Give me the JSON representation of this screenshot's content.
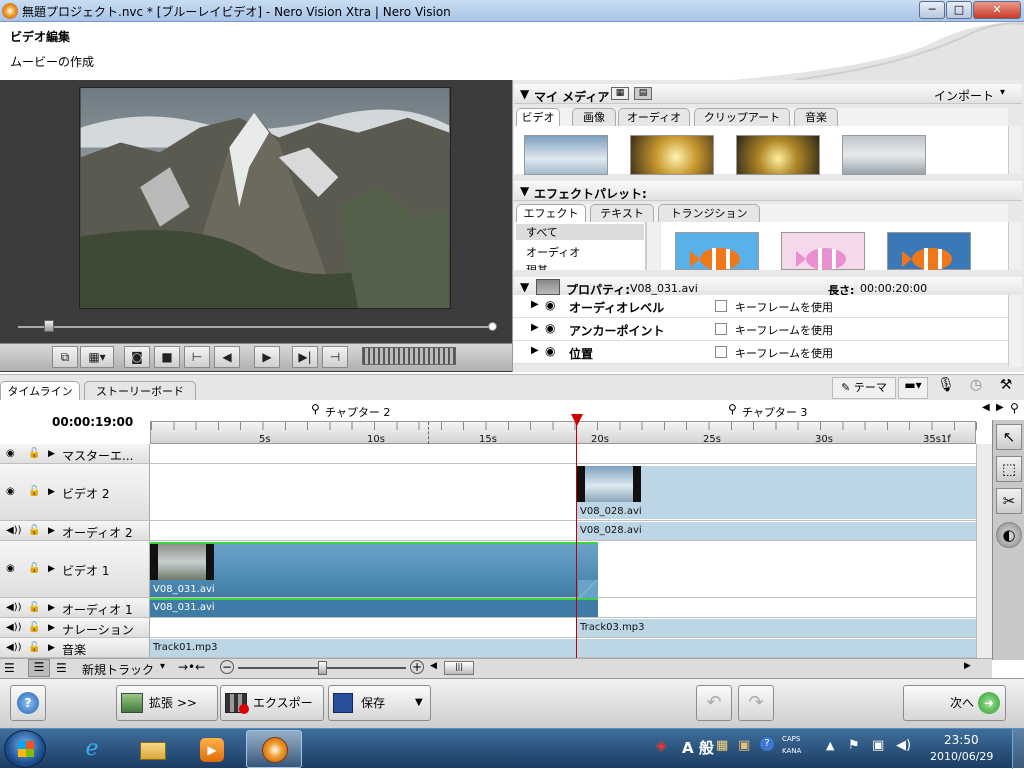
{
  "window": {
    "title": "無題プロジェクト.nvc * [ブルーレイビデオ] - Nero Vision Xtra | Nero Vision",
    "min": "─",
    "max": "□",
    "close": "✕"
  },
  "header": {
    "title": "ビデオ編集",
    "subtitle": "ムービーの作成"
  },
  "my_media": {
    "title": "マイ メディア",
    "import": "インポート",
    "tabs": [
      "ビデオ",
      "画像",
      "オーディオ",
      "クリップアート",
      "音楽"
    ]
  },
  "effects": {
    "title": "エフェクトパレット:",
    "tabs": [
      "エフェクト",
      "テキスト",
      "トランジション"
    ],
    "categories": [
      "すべて",
      "オーディオ",
      "現基"
    ]
  },
  "properties": {
    "label": "プロパティ:",
    "file": "V08_031.avi",
    "length_label": "長さ:",
    "length_value": "00:00:20:00",
    "rows": [
      {
        "name": "オーディオレベル",
        "check": "キーフレームを使用"
      },
      {
        "name": "アンカーポイント",
        "check": "キーフレームを使用"
      },
      {
        "name": "位置",
        "check": "キーフレームを使用"
      }
    ]
  },
  "timeline": {
    "tabs": [
      "タイムライン",
      "ストーリーボード"
    ],
    "theme": "テーマ",
    "timecode": "00:00:19:00",
    "chapters": [
      "チャプター 2",
      "チャプター 3"
    ],
    "ticks": [
      "5s",
      "10s",
      "15s",
      "20s",
      "25s",
      "30s",
      "35s1f"
    ],
    "tracks": [
      "マスターエ...",
      "ビデオ 2",
      "オーディオ 2",
      "ビデオ 1",
      "オーディオ 1",
      "ナレーション",
      "音楽"
    ],
    "clips": {
      "video2": "V08_028.avi",
      "audio2": "V08_028.avi",
      "video1": "V08_031.avi",
      "audio1": "V08_031.avi",
      "narration": "Track03.mp3",
      "music": "Track01.mp3"
    },
    "new_track": "新規トラック"
  },
  "footer": {
    "help": "?",
    "expand": "拡張 >>",
    "export": "エクスポート",
    "save": "保存",
    "next": "次へ"
  },
  "taskbar": {
    "ime": "A 般",
    "caps": "CAPS",
    "kana": "KANA",
    "time": "23:50",
    "date": "2010/06/29"
  }
}
